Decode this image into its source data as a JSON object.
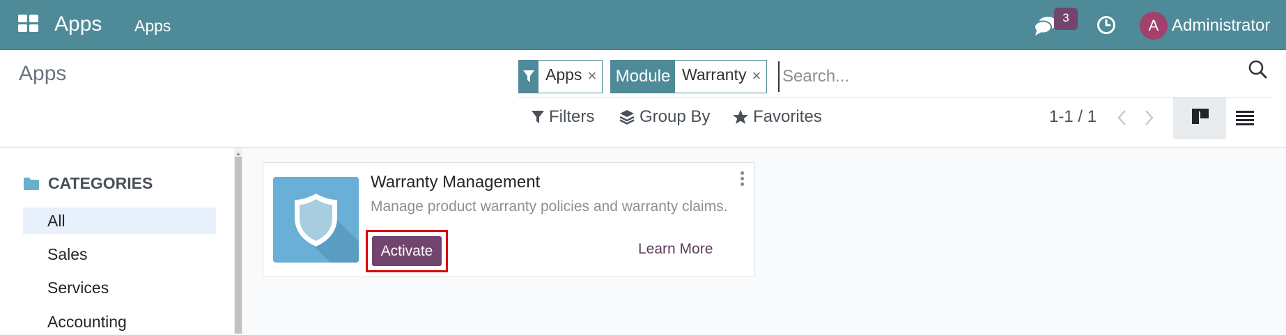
{
  "colors": {
    "navbar": "#4e8a98",
    "brand": "#71456d",
    "avatar": "#a1416c",
    "highlight": "#dd0000",
    "app_icon": "#6aafd6"
  },
  "navbar": {
    "app_name": "Apps",
    "menu_item": "Apps",
    "chat_badge": "3",
    "avatar_letter": "A",
    "user_name": "Administrator",
    "icons": [
      "apps-grid-icon",
      "chat-icon",
      "clock-icon"
    ]
  },
  "control_panel": {
    "breadcrumb": "Apps",
    "facets": [
      {
        "label_icon": "filter-icon",
        "value": "Apps",
        "remove": "×"
      },
      {
        "label": "Module",
        "value": "Warranty",
        "remove": "×"
      }
    ],
    "search_placeholder": "Search...",
    "filters_label": "Filters",
    "group_by_label": "Group By",
    "favorites_label": "Favorites",
    "pager": "1-1 / 1",
    "views": [
      "kanban-view-icon",
      "list-view-icon"
    ],
    "active_view": "kanban"
  },
  "sidebar": {
    "header": "CATEGORIES",
    "items": [
      {
        "label": "All",
        "active": true
      },
      {
        "label": "Sales",
        "active": false
      },
      {
        "label": "Services",
        "active": false
      },
      {
        "label": "Accounting",
        "active": false
      }
    ]
  },
  "card": {
    "title": "Warranty Management",
    "description": "Manage product warranty policies and warranty claims.",
    "activate_label": "Activate",
    "learn_more_label": "Learn More",
    "icon": "shield-icon"
  }
}
